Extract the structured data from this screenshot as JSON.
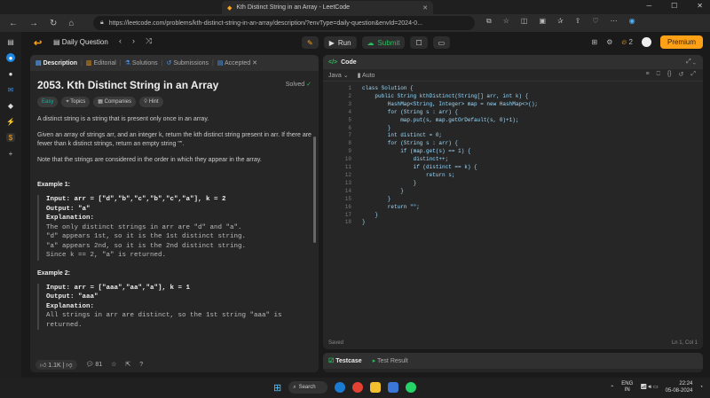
{
  "browser": {
    "tab_title": "Kth Distinct String in an Array - LeetCode",
    "url": "https://leetcode.com/problems/kth-distinct-string-in-an-array/description/?envType=daily-question&envId=2024-0..."
  },
  "lc": {
    "daily": "Daily Question",
    "run": "Run",
    "submit": "Submit",
    "streak": "2",
    "premium": "Premium"
  },
  "desc": {
    "tabs": [
      "Description",
      "Editorial",
      "Solutions",
      "Submissions",
      "Accepted"
    ],
    "title": "2053. Kth Distinct String in an Array",
    "solved": "Solved",
    "chips": [
      "Easy",
      "Topics",
      "Companies",
      "Hint"
    ],
    "p1": "A distinct string is a string that is present only once in an array.",
    "p2": "Given an array of strings arr, and an integer k, return the kth distinct string present in arr. If there are fewer than k distinct strings, return an empty string \"\".",
    "p3": "Note that the strings are considered in the order in which they appear in the array.",
    "ex1_title": "Example 1:",
    "ex1": [
      "Input: arr = [\"d\",\"b\",\"c\",\"b\",\"c\",\"a\"], k = 2",
      "Output: \"a\"",
      "Explanation:",
      "The only distinct strings in arr are \"d\" and \"a\".",
      "\"d\" appears 1st, so it is the 1st distinct string.",
      "\"a\" appears 2nd, so it is the 2nd distinct string.",
      "Since k == 2, \"a\" is returned."
    ],
    "ex2_title": "Example 2:",
    "ex2": [
      "Input: arr = [\"aaa\",\"aa\",\"a\"], k = 1",
      "Output: \"aaa\"",
      "Explanation:",
      "All strings in arr are distinct, so the 1st string \"aaa\" is",
      "returned."
    ],
    "likes": "1.1K",
    "comments": "81"
  },
  "code": {
    "title": "Code",
    "lang": "Java",
    "auto": "Auto",
    "saved": "Saved",
    "pos": "Ln 1, Col 1",
    "lines": [
      "class Solution {",
      "    public String kthDistinct(String[] arr, int k) {",
      "        HashMap<String, Integer> map = new HashMap<>();",
      "        for (String s : arr) {",
      "            map.put(s, map.getOrDefault(s, 0)+1);",
      "        }",
      "        int distinct = 0;",
      "        for (String s : arr) {",
      "            if (map.get(s) == 1) {",
      "                distinct++;",
      "                if (distinct == k) {",
      "                    return s;",
      "                }",
      "            }",
      "        }",
      "        return \"\";",
      "    }",
      "}"
    ]
  },
  "test": {
    "testcase": "Testcase",
    "result": "Test Result"
  },
  "taskbar": {
    "search": "Search",
    "lang": "ENG",
    "region": "IN",
    "time": "22:24",
    "date": "05-08-2024"
  }
}
